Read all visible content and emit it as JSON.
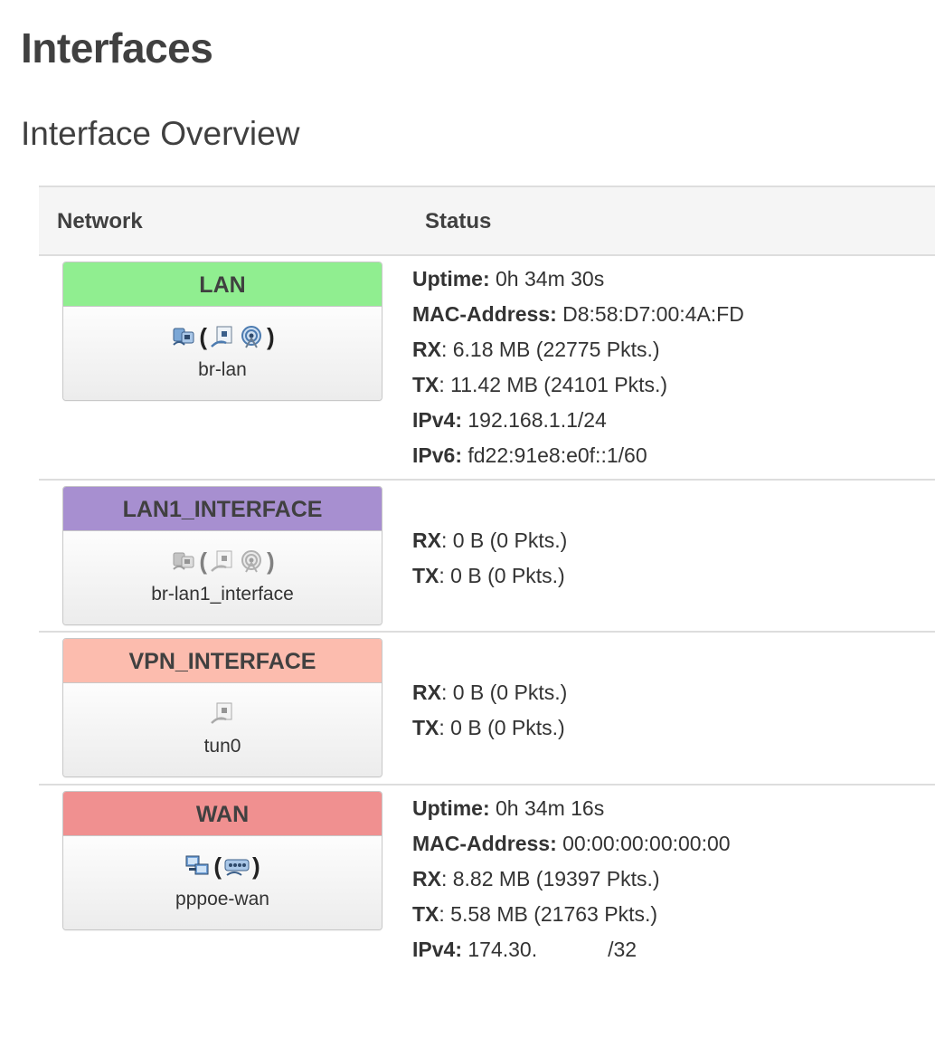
{
  "page": {
    "title": "Interfaces",
    "section": "Interface Overview"
  },
  "table": {
    "col_network": "Network",
    "col_status": "Status"
  },
  "interfaces": [
    {
      "name": "LAN",
      "color": "#90ee90",
      "ifname": "br-lan",
      "icons": [
        "ethernet-icon",
        "bridge-port-icon",
        "wireless-icon"
      ],
      "status": {
        "uptime_label": "Uptime:",
        "uptime": "0h 34m 30s",
        "mac_label": "MAC-Address:",
        "mac": "D8:58:D7:00:4A:FD",
        "rx_label": "RX",
        "rx": ": 6.18 MB (22775 Pkts.)",
        "tx_label": "TX",
        "tx": ": 11.42 MB (24101 Pkts.)",
        "ipv4_label": "IPv4:",
        "ipv4": "192.168.1.1/24",
        "ipv6_label": "IPv6:",
        "ipv6": "fd22:91e8:e0f::1/60"
      }
    },
    {
      "name": "LAN1_INTERFACE",
      "color": "#a78fd0",
      "ifname": "br-lan1_interface",
      "icons": [
        "ethernet-icon",
        "bridge-port-icon",
        "wireless-icon"
      ],
      "status": {
        "rx_label": "RX",
        "rx": ": 0 B (0 Pkts.)",
        "tx_label": "TX",
        "tx": ": 0 B (0 Pkts.)"
      }
    },
    {
      "name": "VPN_INTERFACE",
      "color": "#fcbcae",
      "ifname": "tun0",
      "icons": [
        "tunnel-icon"
      ],
      "status": {
        "rx_label": "RX",
        "rx": ": 0 B (0 Pkts.)",
        "tx_label": "TX",
        "tx": ": 0 B (0 Pkts.)"
      }
    },
    {
      "name": "WAN",
      "color": "#f09090",
      "ifname": "pppoe-wan",
      "icons": [
        "pppoe-icon",
        "ethernet-switch-icon"
      ],
      "status": {
        "uptime_label": "Uptime:",
        "uptime": "0h 34m 16s",
        "mac_label": "MAC-Address:",
        "mac": "00:00:00:00:00:00",
        "rx_label": "RX",
        "rx": ": 8.82 MB (19397 Pkts.)",
        "tx_label": "TX",
        "tx": ": 5.58 MB (21763 Pkts.)",
        "ipv4_label": "IPv4:",
        "ipv4_prefix": "174.30.",
        "ipv4_suffix": "/32"
      }
    }
  ]
}
